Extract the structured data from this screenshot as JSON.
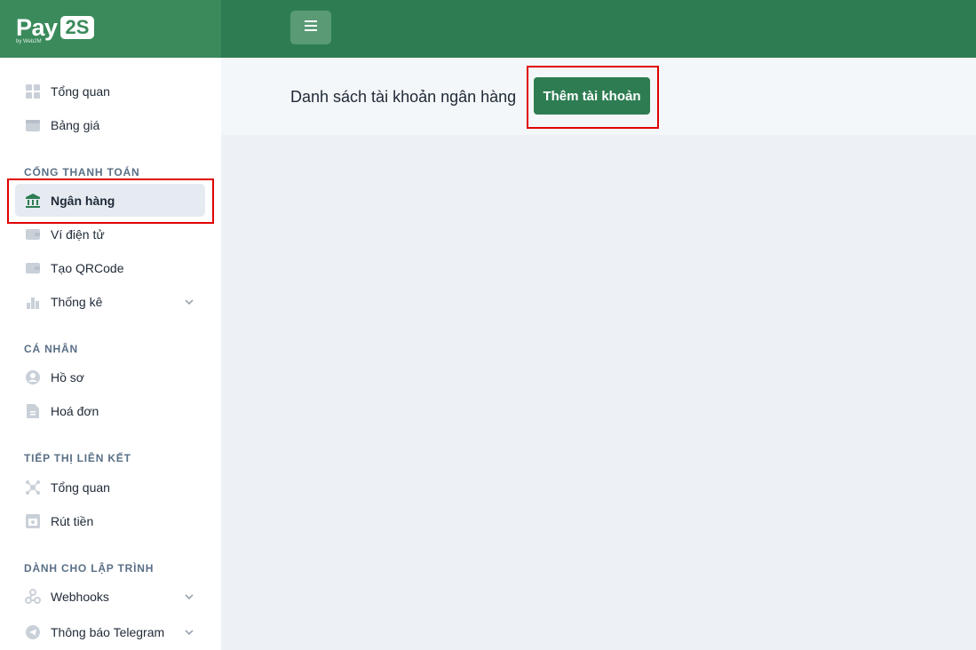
{
  "brand": {
    "logo_pay": "Pay",
    "logo_2s": "2S",
    "logo_by": "by Web2M"
  },
  "header": {
    "page_title": "Danh sách tài khoản ngân hàng",
    "add_button": "Thêm tài khoản"
  },
  "sidebar": {
    "items": [
      {
        "label": "Tổng quan",
        "icon": "grid-icon"
      },
      {
        "label": "Bảng giá",
        "icon": "box-icon"
      }
    ],
    "sections": [
      {
        "title": "CỔNG THANH TOÁN",
        "items": [
          {
            "label": "Ngân hàng",
            "icon": "bank-icon",
            "active": true
          },
          {
            "label": "Ví điện tử",
            "icon": "wallet-icon"
          },
          {
            "label": "Tạo QRCode",
            "icon": "wallet-icon"
          },
          {
            "label": "Thống kê",
            "icon": "bar-chart-icon",
            "expandable": true
          }
        ]
      },
      {
        "title": "CÁ NHÂN",
        "items": [
          {
            "label": "Hồ sơ",
            "icon": "user-icon"
          },
          {
            "label": "Hoá đơn",
            "icon": "invoice-icon"
          }
        ]
      },
      {
        "title": "TIẾP THỊ LIÊN KẾT",
        "items": [
          {
            "label": "Tổng quan",
            "icon": "network-icon"
          },
          {
            "label": "Rút tiền",
            "icon": "withdraw-icon"
          }
        ]
      },
      {
        "title": "DÀNH CHO LẬP TRÌNH",
        "items": [
          {
            "label": "Webhooks",
            "icon": "webhook-icon",
            "expandable": true
          },
          {
            "label": "Thông báo Telegram",
            "icon": "telegram-icon",
            "expandable": true
          }
        ]
      }
    ]
  },
  "colors": {
    "brand_green": "#2e7d52",
    "highlight": "#e00000",
    "active_bg": "#e5ebf1"
  }
}
